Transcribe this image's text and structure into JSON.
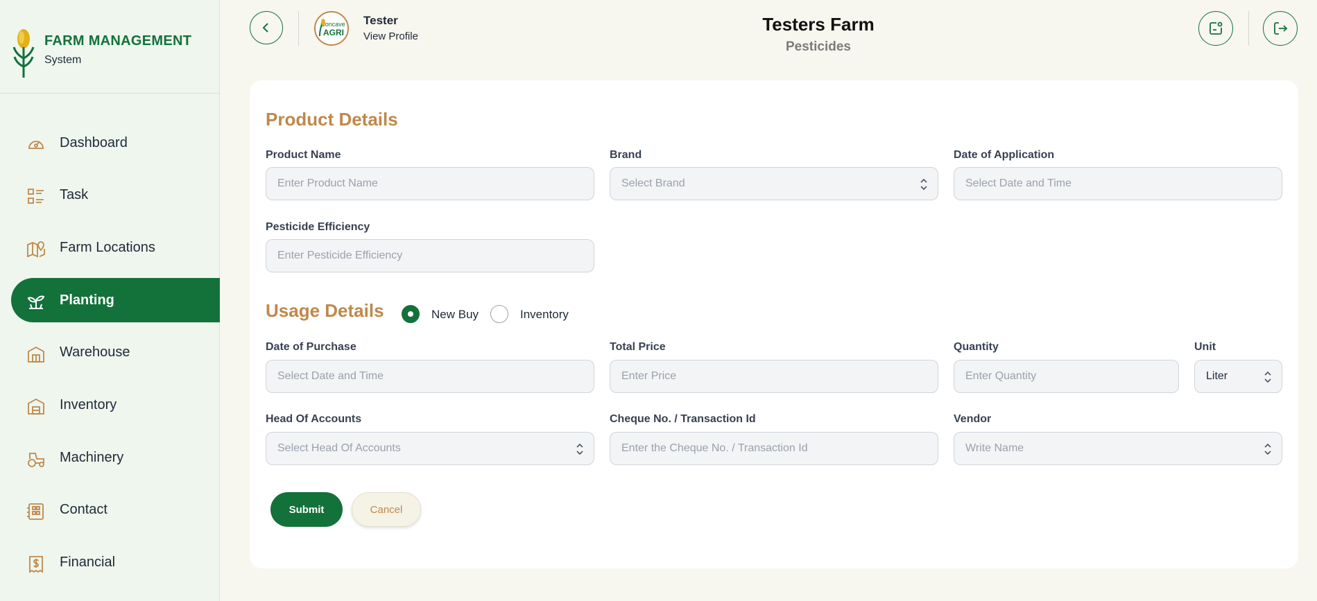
{
  "brand": {
    "title": "FARM MANAGEMENT",
    "subtitle": "System"
  },
  "sidebar": {
    "items": [
      {
        "label": "Dashboard",
        "icon": "dashboard-gauge-icon"
      },
      {
        "label": "Task",
        "icon": "task-list-icon"
      },
      {
        "label": "Farm Locations",
        "icon": "map-pin-icon"
      },
      {
        "label": "Planting",
        "icon": "plant-sprout-icon",
        "active": true
      },
      {
        "label": "Warehouse",
        "icon": "warehouse-building-icon"
      },
      {
        "label": "Inventory",
        "icon": "inventory-building-icon"
      },
      {
        "label": "Machinery",
        "icon": "tractor-icon"
      },
      {
        "label": "Contact",
        "icon": "contact-card-icon"
      },
      {
        "label": "Financial",
        "icon": "receipt-dollar-icon"
      }
    ]
  },
  "header": {
    "user_name": "Tester",
    "user_link": "View Profile",
    "avatar_text_top": "Concave",
    "avatar_text_bottom": "AGRI",
    "farm_title": "Testers Farm",
    "farm_subtitle": "Pesticides"
  },
  "product": {
    "section_title": "Product Details",
    "product_name_label": "Product Name",
    "product_name_placeholder": "Enter Product Name",
    "brand_label": "Brand",
    "brand_placeholder": "Select Brand",
    "date_application_label": "Date of Application",
    "date_application_placeholder": "Select Date and Time",
    "efficiency_label": "Pesticide Efficiency",
    "efficiency_placeholder": "Enter Pesticide Efficiency"
  },
  "usage": {
    "section_title": "Usage Details",
    "radio_new_buy": "New Buy",
    "radio_inventory": "Inventory",
    "selected": "New Buy",
    "date_purchase_label": "Date of Purchase",
    "date_purchase_placeholder": "Select Date and Time",
    "total_price_label": "Total Price",
    "total_price_placeholder": "Enter Price",
    "quantity_label": "Quantity",
    "quantity_placeholder": "Enter Quantity",
    "unit_label": "Unit",
    "unit_value": "Liter",
    "head_accounts_label": "Head Of Accounts",
    "head_accounts_placeholder": "Select Head Of Accounts",
    "cheque_label": "Cheque No. / Transaction Id",
    "cheque_placeholder": "Enter the Cheque No. / Transaction Id",
    "vendor_label": "Vendor",
    "vendor_placeholder": "Write Name"
  },
  "actions": {
    "submit": "Submit",
    "cancel": "Cancel"
  },
  "colors": {
    "primary": "#13713a",
    "accent": "#c0884a",
    "background": "#f7f6ef",
    "sidebar": "#eef6ee"
  }
}
